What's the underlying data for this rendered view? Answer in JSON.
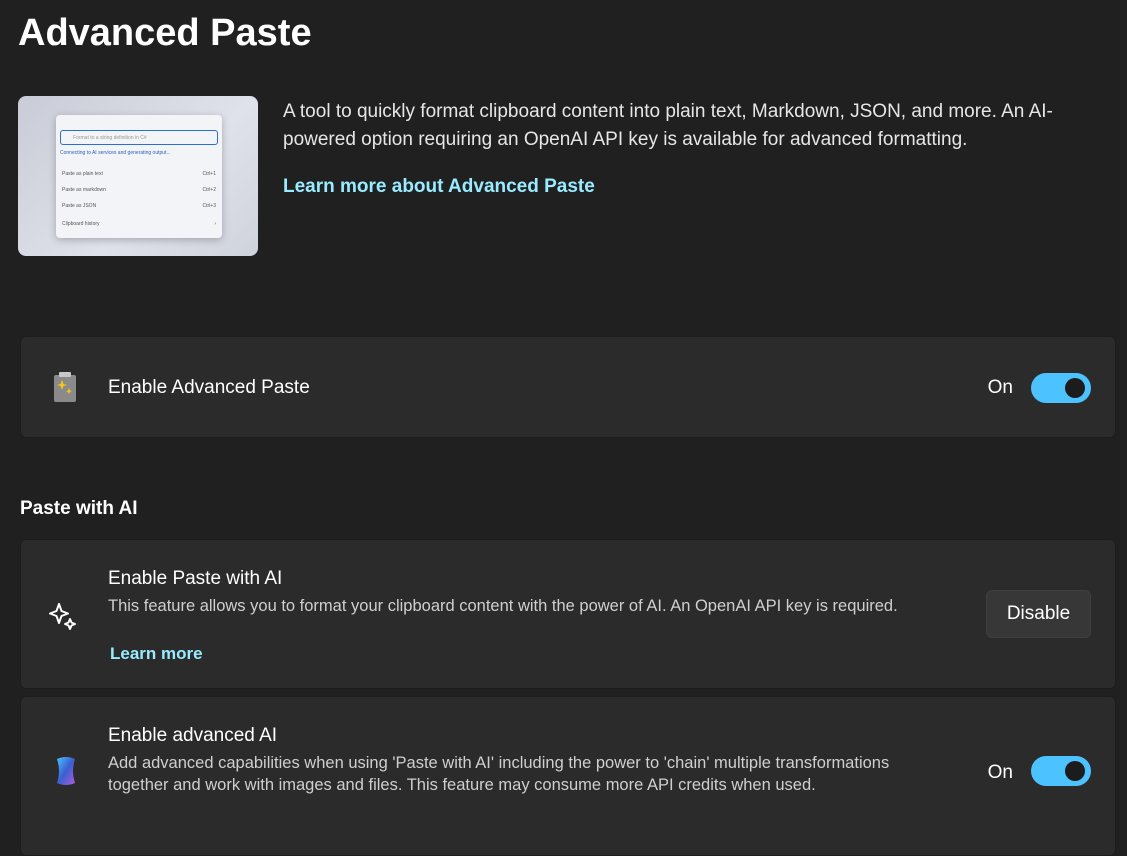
{
  "page": {
    "title": "Advanced Paste",
    "description": "A tool to quickly format clipboard content into plain text, Markdown, JSON, and more. An AI-powered option requiring an OpenAI API key is available for advanced formatting.",
    "learn_more": "Learn more about Advanced Paste"
  },
  "hero": {
    "search_placeholder": "Format to a string definition in C#",
    "status": "Connecting to AI services and generating output...",
    "items": [
      {
        "label": "Paste as plain text",
        "shortcut": "Ctrl+1"
      },
      {
        "label": "Paste as markdown",
        "shortcut": "Ctrl+2"
      },
      {
        "label": "Paste as JSON",
        "shortcut": "Ctrl+3"
      },
      {
        "label": "Clipboard history",
        "shortcut": "›"
      }
    ]
  },
  "enable": {
    "label": "Enable Advanced Paste",
    "state": "On"
  },
  "section": {
    "title": "Paste with AI"
  },
  "paste_ai": {
    "title": "Enable Paste with AI",
    "desc": "This feature allows you to format your clipboard content with the power of AI. An OpenAI API key is required.",
    "link": "Learn more",
    "button": "Disable"
  },
  "advanced_ai": {
    "title": "Enable advanced AI",
    "desc": "Add advanced capabilities when using 'Paste with AI' including the power to 'chain' multiple transformations together and work with images and files. This feature may consume more API credits when used.",
    "state": "On"
  },
  "colors": {
    "accent": "#4cc2ff",
    "link": "#99ebff",
    "card": "#2b2b2b",
    "bg": "#202020"
  }
}
